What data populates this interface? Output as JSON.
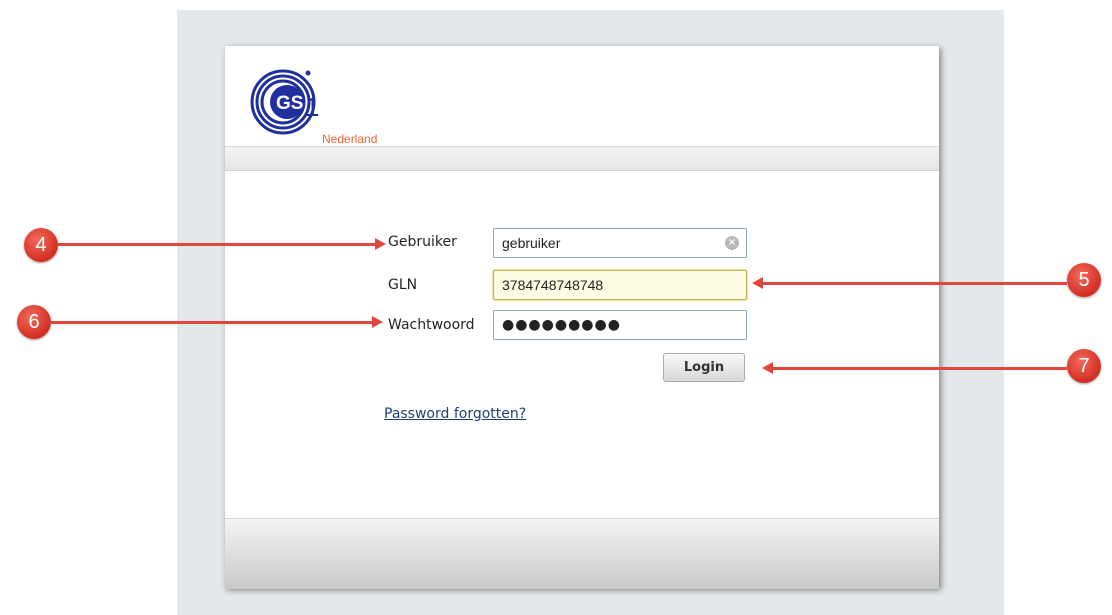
{
  "logo": {
    "text": "GS1",
    "subtitle": "Nederland"
  },
  "form": {
    "user_label": "Gebruiker",
    "user_value": "gebruiker",
    "gln_label": "GLN",
    "gln_value": "3784748748748",
    "password_label": "Wachtwoord",
    "password_mask": "●●●●●●●●●",
    "login_label": "Login",
    "forgot_link": "Password forgotten?"
  },
  "annotations": [
    {
      "number": "4"
    },
    {
      "number": "5"
    },
    {
      "number": "6"
    },
    {
      "number": "7"
    }
  ],
  "colors": {
    "badge": "#d22e22",
    "arrow": "#e0463a",
    "logo_blue": "#1f2f9e",
    "logo_orange": "#f26334",
    "field_highlight": "#fdfde3"
  }
}
